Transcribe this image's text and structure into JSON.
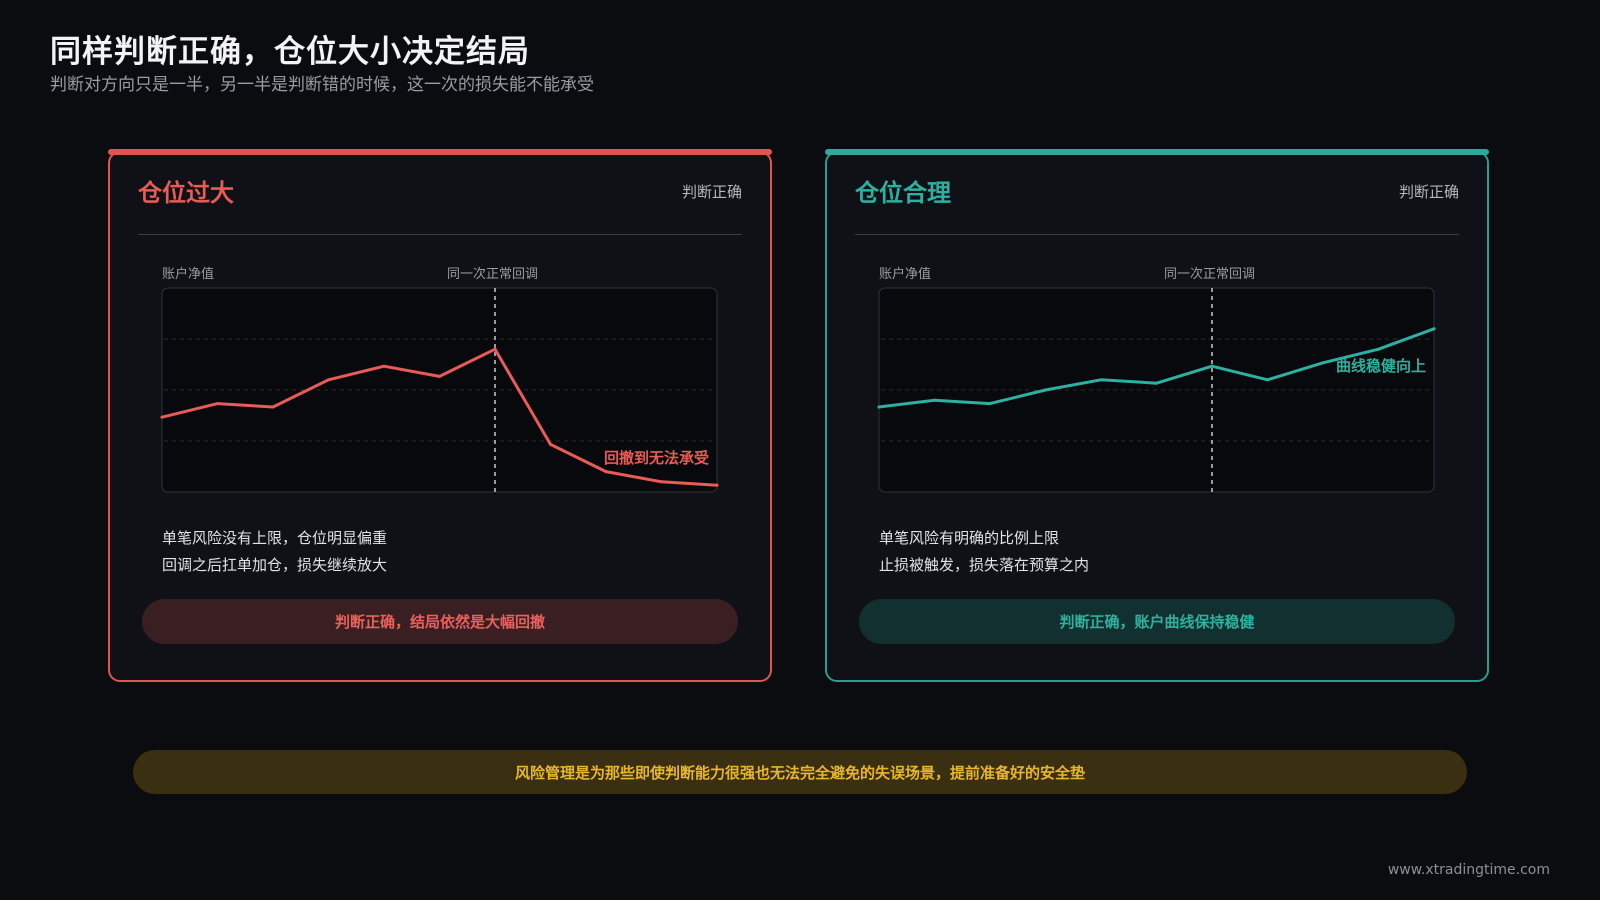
{
  "header": {
    "title": "同样判断正确，仓位大小决定结局",
    "subtitle": "判断对方向只是一半，另一半是判断错的时候，这一次的损失能不能承受"
  },
  "left_card": {
    "title": "仓位过大",
    "tag": "判断正确",
    "chart_y_label": "账户净值",
    "chart_marker_label": "同一次正常回调",
    "chart_annotation": "回撤到无法承受",
    "desc_line1": "单笔风险没有上限，仓位明显偏重",
    "desc_line2": "回调之后扛单加仓，损失继续放大",
    "verdict": "判断正确，结局依然是大幅回撤",
    "color": "#e85b56"
  },
  "right_card": {
    "title": "仓位合理",
    "tag": "判断正确",
    "chart_y_label": "账户净值",
    "chart_marker_label": "同一次正常回调",
    "chart_annotation": "曲线稳健向上",
    "desc_line1": "单笔风险有明确的比例上限",
    "desc_line2": "止损被触发，损失落在预算之内",
    "verdict": "判断正确，账户曲线保持稳健",
    "color": "#2eb0a0"
  },
  "footer": {
    "banner": "风险管理是为那些即使判断能力很强也无法完全避免的失误场景，提前准备好的安全垫",
    "site": "www.xtradingtime.com"
  },
  "chart_data": [
    {
      "type": "line",
      "x": [
        0,
        1,
        2,
        3,
        4,
        5,
        6,
        7,
        8,
        9,
        10
      ],
      "values": [
        22,
        26,
        25,
        33,
        37,
        34,
        42,
        14,
        6,
        3,
        2
      ],
      "ylim": [
        0,
        60
      ],
      "marker_index": 6,
      "grid": true,
      "title": "",
      "xlabel": "",
      "ylabel": "账户净值"
    },
    {
      "type": "line",
      "x": [
        0,
        1,
        2,
        3,
        4,
        5,
        6,
        7,
        8,
        9,
        10
      ],
      "values": [
        25,
        27,
        26,
        30,
        33,
        32,
        37,
        33,
        38,
        42,
        48
      ],
      "ylim": [
        0,
        60
      ],
      "marker_index": 6,
      "grid": true,
      "title": "",
      "xlabel": "",
      "ylabel": "账户净值"
    }
  ]
}
